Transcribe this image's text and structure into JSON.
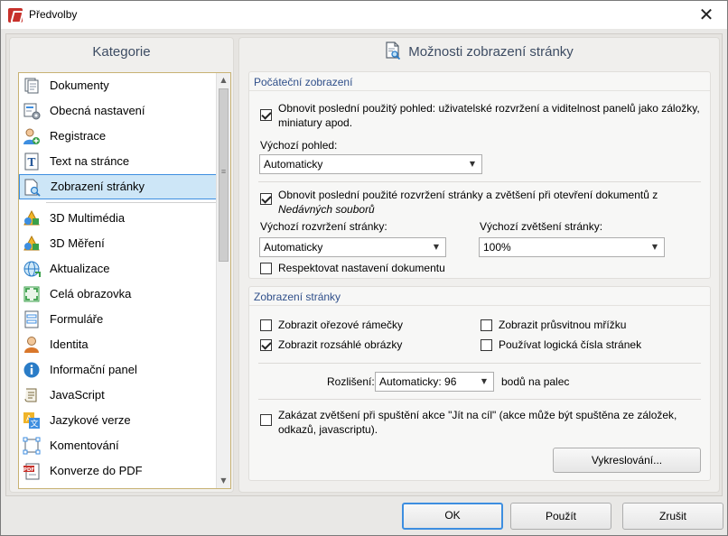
{
  "window": {
    "title": "Předvolby",
    "close_glyph": "✕",
    "app_icon": "pdf-editor-app-icon"
  },
  "categories": {
    "header": "Kategorie",
    "items": [
      {
        "label": "Dokumenty",
        "icon": "documents-icon"
      },
      {
        "label": "Obecná nastavení",
        "icon": "general-settings-icon"
      },
      {
        "label": "Registrace",
        "icon": "registration-user-icon"
      },
      {
        "label": "Text na stránce",
        "icon": "text-on-page-icon"
      },
      {
        "label": "Zobrazení stránky",
        "icon": "page-display-icon",
        "selected": true
      },
      {
        "label": "3D Multimédia",
        "icon": "3d-multimedia-icon"
      },
      {
        "label": "3D Měření",
        "icon": "3d-measure-icon"
      },
      {
        "label": "Aktualizace",
        "icon": "updates-globe-icon"
      },
      {
        "label": "Celá obrazovka",
        "icon": "fullscreen-icon"
      },
      {
        "label": "Formuláře",
        "icon": "forms-icon"
      },
      {
        "label": "Identita",
        "icon": "identity-person-icon"
      },
      {
        "label": "Informační panel",
        "icon": "info-panel-icon"
      },
      {
        "label": "JavaScript",
        "icon": "javascript-scroll-icon"
      },
      {
        "label": "Jazykové verze",
        "icon": "language-icon"
      },
      {
        "label": "Komentování",
        "icon": "commenting-icon"
      },
      {
        "label": "Konverze do PDF",
        "icon": "convert-to-pdf-icon"
      }
    ],
    "scroll_up": "▲",
    "scroll_down": "▼"
  },
  "options": {
    "header": "Možnosti zobrazení stránky",
    "header_icon": "page-magnifier-icon",
    "initial_view": {
      "title": "Počáteční zobrazení",
      "restore_view_label": "Obnovit poslední použitý pohled: uživatelské rozvržení a viditelnost panelů jako záložky, miniatury apod.",
      "restore_view_checked": true,
      "default_view_label": "Výchozí pohled:",
      "default_view_value": "Automaticky",
      "restore_layout_label_main": "Obnovit poslední použité rozvržení stránky a zvětšení při otevření dokumentů z",
      "restore_layout_label_italic": "Nedávných souborů",
      "restore_layout_checked": true,
      "default_layout_label": "Výchozí rozvržení stránky:",
      "default_layout_value": "Automaticky",
      "default_zoom_label": "Výchozí zvětšení stránky:",
      "default_zoom_value": "100%",
      "respect_doc_label": "Respektovat nastavení dokumentu",
      "respect_doc_checked": false
    },
    "page_display": {
      "title": "Zobrazení stránky",
      "crop_boxes_label": "Zobrazit ořezové rámečky",
      "crop_boxes_checked": false,
      "transparent_grid_label": "Zobrazit průsvitnou mřížku",
      "transparent_grid_checked": false,
      "large_images_label": "Zobrazit rozsáhlé obrázky",
      "large_images_checked": true,
      "logical_numbers_label": "Používat logická čísla stránek",
      "logical_numbers_checked": false,
      "resolution_label": "Rozlišení:",
      "resolution_value": "Automaticky: 96",
      "resolution_unit": "bodů na palec",
      "disable_zoom_label": "Zakázat zvětšení při spuštění akce \"Jít na cíl\" (akce může být spuštěna ze záložek, odkazů, javascriptu).",
      "disable_zoom_checked": false,
      "rendering_button": "Vykreslování..."
    },
    "caret": "▼"
  },
  "footer": {
    "ok": "OK",
    "apply": "Použít",
    "cancel": "Zrušit"
  }
}
